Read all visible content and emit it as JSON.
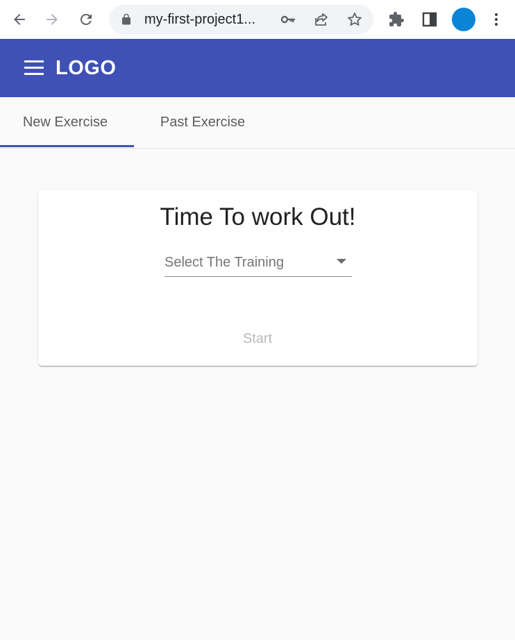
{
  "browser": {
    "url": "my-first-project1...",
    "icons": [
      "back-icon",
      "forward-icon",
      "reload-icon",
      "lock-icon",
      "key-icon",
      "share-icon",
      "star-icon",
      "extensions-icon",
      "sidepanel-icon",
      "profile-avatar",
      "more-icon"
    ],
    "avatar_color": "#0a84d6"
  },
  "toolbar": {
    "logo": "LOGO",
    "color": "#3f51b5",
    "menu_icon": "hamburger-menu-icon"
  },
  "tabs": [
    {
      "label": "New Exercise",
      "active": true
    },
    {
      "label": "Past Exercise",
      "active": false
    }
  ],
  "card": {
    "title": "Time To work Out!",
    "select": {
      "placeholder": "Select The Training"
    },
    "start_label": "Start"
  }
}
